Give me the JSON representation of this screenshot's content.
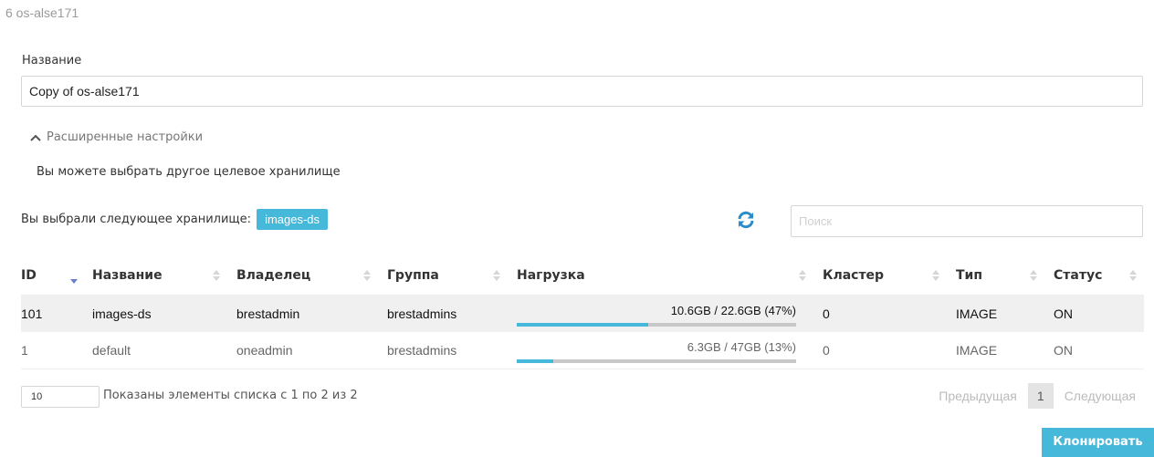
{
  "window": {
    "title": "6 os-alse171"
  },
  "form": {
    "name_label": "Название",
    "name_value": "Copy of os-alse171",
    "advanced_toggle": "Расширенные настройки",
    "hint": "Вы можете выбрать другое целевое хранилище",
    "selected_label": "Вы выбрали следующее хранилище:",
    "selected_value": "images-ds",
    "search_placeholder": "Поиск"
  },
  "table": {
    "columns": [
      "ID",
      "Название",
      "Владелец",
      "Группа",
      "Нагрузка",
      "Кластер",
      "Тип",
      "Статус"
    ],
    "sorted_column": "ID",
    "rows": [
      {
        "id": "101",
        "name": "images-ds",
        "owner": "brestadmin",
        "group": "brestadmins",
        "load": "10.6GB / 22.6GB (47%)",
        "load_fraction": 0.47,
        "cluster": "0",
        "type": "IMAGE",
        "status": "ON",
        "selected": true
      },
      {
        "id": "1",
        "name": "default",
        "owner": "oneadmin",
        "group": "brestadmins",
        "load": "6.3GB / 47GB (13%)",
        "load_fraction": 0.13,
        "cluster": "0",
        "type": "IMAGE",
        "status": "ON",
        "selected": false
      }
    ]
  },
  "pagination": {
    "page_size": "10",
    "info": "Показаны элементы списка с 1 по 2 из 2",
    "prev": "Предыдущая",
    "current": "1",
    "next": "Следующая"
  },
  "actions": {
    "clone": "Клонировать"
  },
  "colors": {
    "accent": "#46b8da",
    "selected_row": "#f0f0f0",
    "bar_track": "#c8c8c8"
  },
  "icons": {
    "toggle": "chevron-up-icon",
    "refresh": "refresh-icon",
    "sort": "sort-icon"
  }
}
